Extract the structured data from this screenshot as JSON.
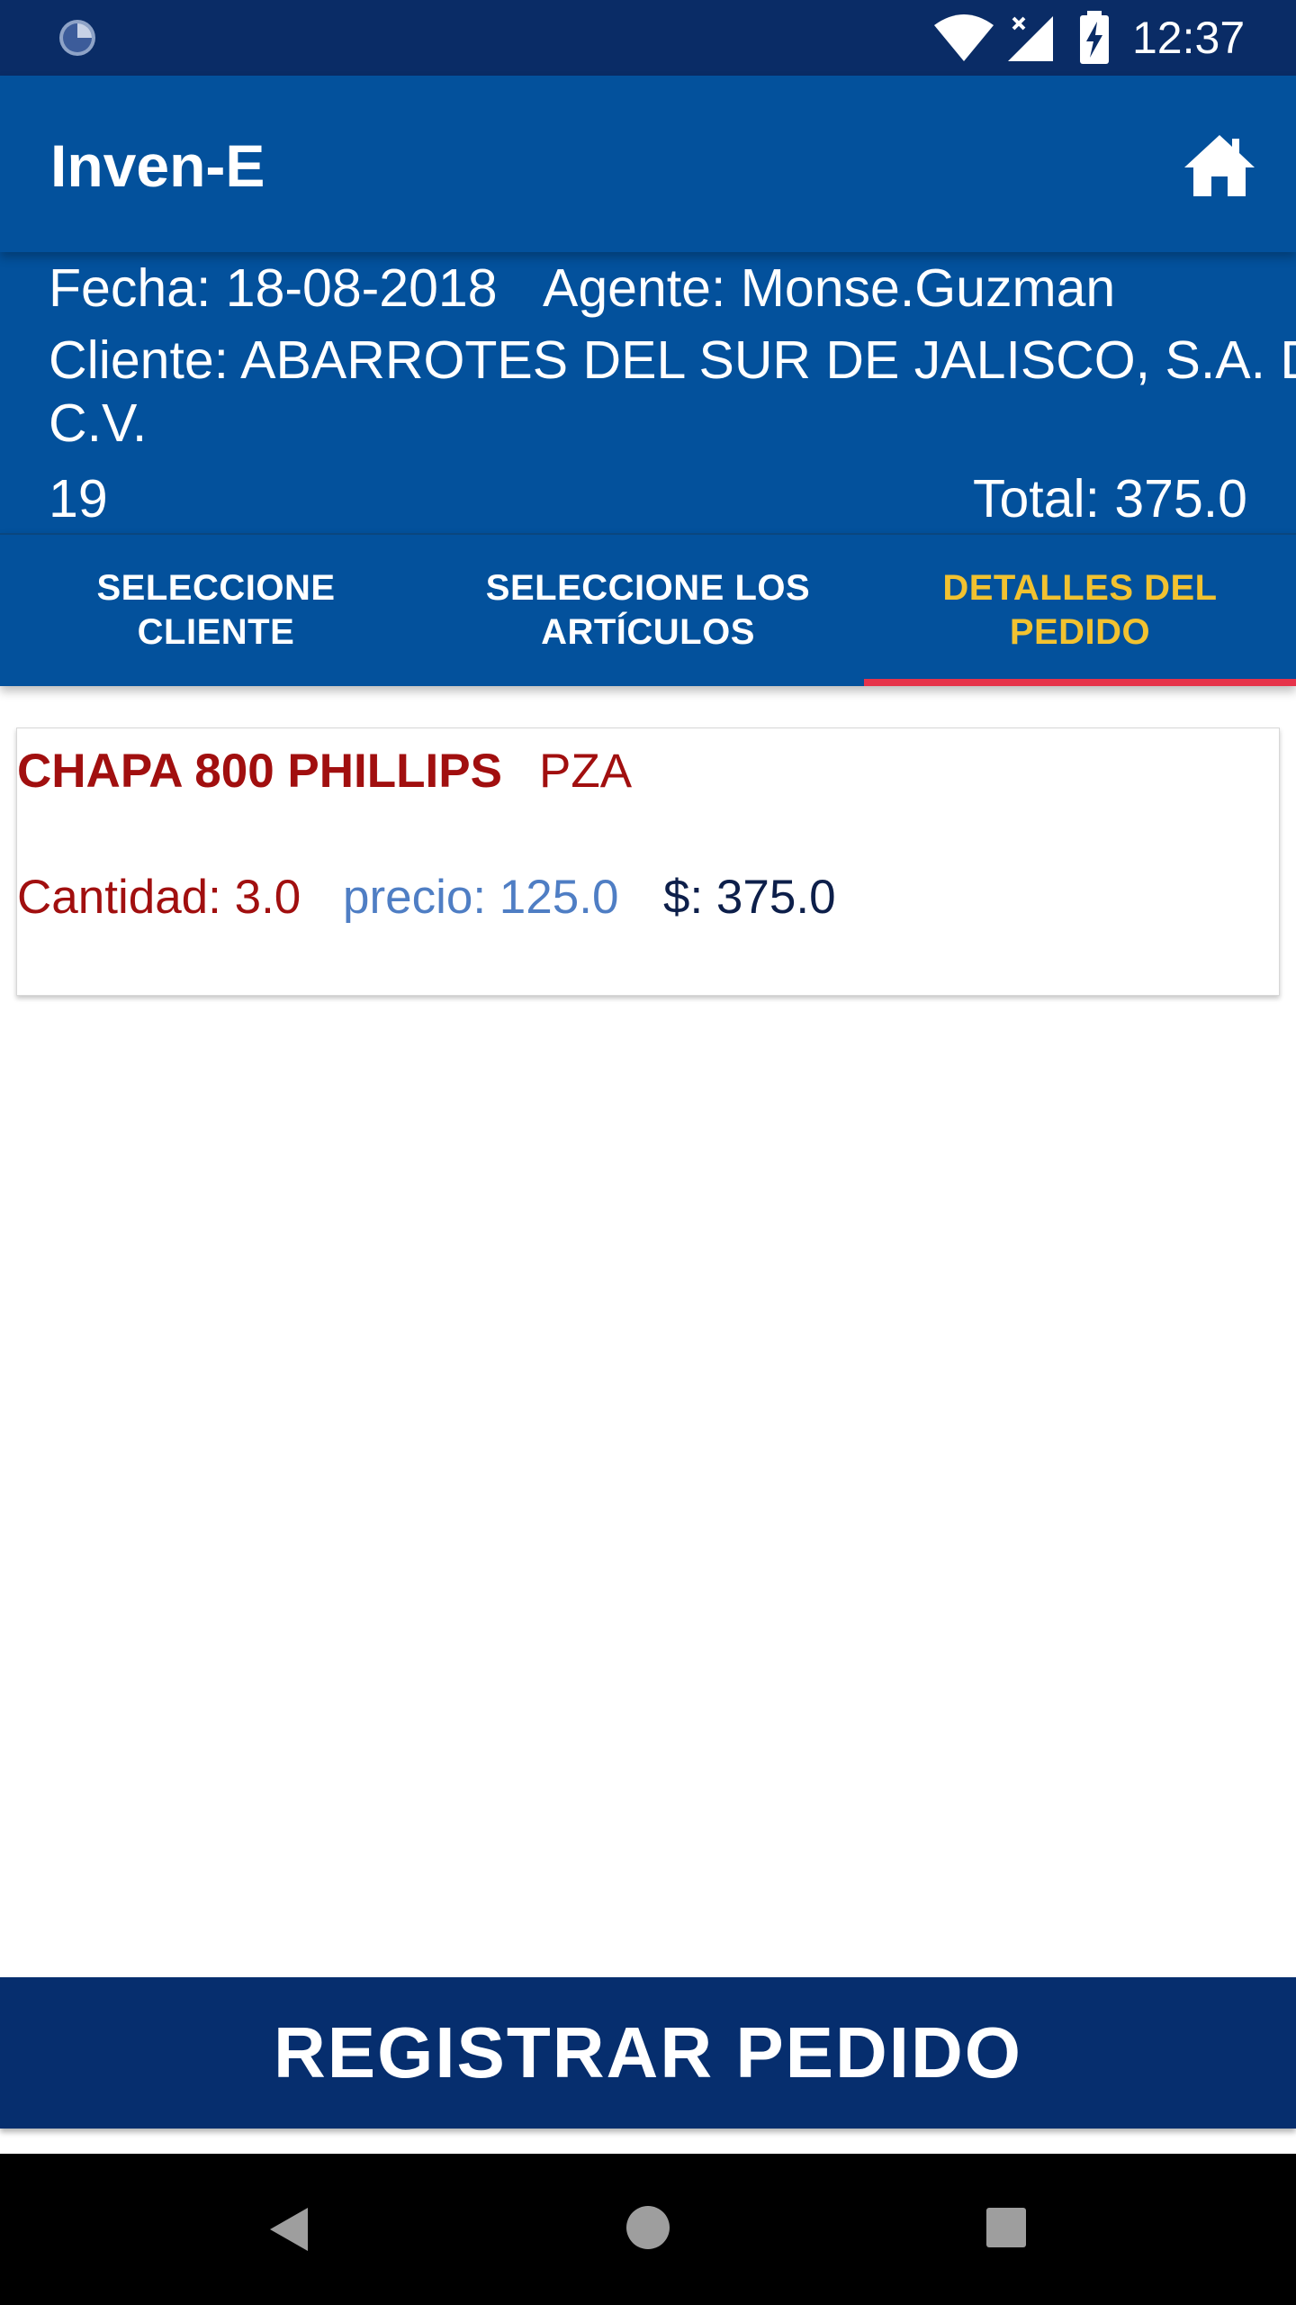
{
  "status_bar": {
    "time": "12:37",
    "icons": [
      "loading-icon",
      "wifi-icon",
      "signal-icon",
      "battery-charging-icon"
    ]
  },
  "app_bar": {
    "title": "Inven-E",
    "home_icon": "home-icon"
  },
  "order_info": {
    "date": "Fecha: 18-08-2018",
    "agent": "Agente: Monse.Guzman",
    "client_line1": "Cliente: ABARROTES DEL SUR DE JALISCO, S.A. DE",
    "client_line2": "C.V.",
    "number": "19",
    "total": "Total: 375.0"
  },
  "tabs": [
    {
      "label_line1": "SELECCIONE",
      "label_line2": "CLIENTE",
      "active": false
    },
    {
      "label_line1": "SELECCIONE LOS",
      "label_line2": "ARTÍCULOS",
      "active": false
    },
    {
      "label_line1": "DETALLES DEL",
      "label_line2": "PEDIDO",
      "active": true
    }
  ],
  "items": [
    {
      "name": "CHAPA 800 PHILLIPS",
      "unit": "PZA",
      "quantity": "Cantidad: 3.0",
      "price": "precio: 125.0",
      "subtotal": "$: 375.0"
    }
  ],
  "register_button": {
    "label": "REGISTRAR PEDIDO"
  },
  "colors": {
    "status_bar": "#0a2c66",
    "app_bar": "#03519c",
    "active_tab_text": "#f2c230",
    "tab_indicator": "#e6334a",
    "product_text": "#a10f0f",
    "price_text": "#4f7ec4",
    "subtotal_text": "#0d1f4a",
    "register_button": "#062e6e"
  },
  "nav_bar": {
    "icons": [
      "back-icon",
      "home-circle-icon",
      "recents-icon"
    ]
  }
}
